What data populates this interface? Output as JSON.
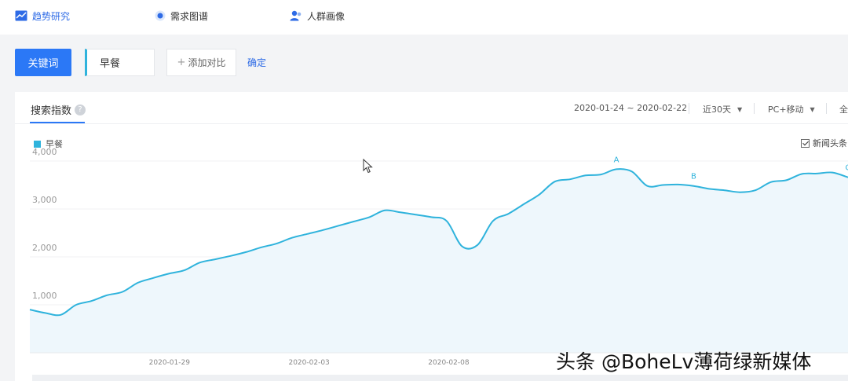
{
  "nav": {
    "items": [
      {
        "label": "趋势研究",
        "icon": "trend-chart-icon"
      },
      {
        "label": "需求图谱",
        "icon": "demand-graph-icon"
      },
      {
        "label": "人群画像",
        "icon": "user-profile-icon"
      }
    ]
  },
  "toolbar": {
    "keyword_btn": "关键词",
    "keyword_value": "早餐",
    "add_compare": "添加对比",
    "confirm": "确定"
  },
  "panel": {
    "tab": "搜索指数",
    "help": "?",
    "date_range": "2020-01-24 ~ 2020-02-22",
    "period": "近30天",
    "device": "PC+移动",
    "region": "全",
    "news_toggle": "新闻头条"
  },
  "watermark": "头条 @BoheLv薄荷绿新媒体",
  "colors": {
    "accent": "#2b78f6",
    "series": "#2fb3dc",
    "area": "#eef7fc"
  },
  "chart_data": {
    "type": "area",
    "series": [
      {
        "name": "早餐",
        "values": [
          900,
          830,
          790,
          1000,
          1080,
          1200,
          1270,
          1460,
          1560,
          1650,
          1720,
          1880,
          1950,
          2020,
          2100,
          2200,
          2280,
          2400,
          2480,
          2560,
          2650,
          2740,
          2830,
          2970,
          2930,
          2880,
          2830,
          2750,
          2220,
          2250,
          2750,
          2900,
          3100,
          3300,
          3570,
          3620,
          3700,
          3720,
          3830,
          3780,
          3480,
          3500,
          3510,
          3480,
          3420,
          3390,
          3350,
          3390,
          3560,
          3600,
          3730,
          3740,
          3760,
          3660
        ]
      }
    ],
    "x_ticks": [
      "2020-01-29",
      "2020-02-03",
      "2020-02-08"
    ],
    "y_ticks": [
      1000,
      2000,
      3000,
      4000
    ],
    "y_tick_labels": [
      "1,000",
      "2,000",
      "3,000",
      "4,000"
    ],
    "ylim": [
      0,
      4100
    ],
    "annotations": [
      {
        "label": "A",
        "index": 38
      },
      {
        "label": "B",
        "index": 43
      },
      {
        "label": "C",
        "index": 53
      }
    ]
  }
}
